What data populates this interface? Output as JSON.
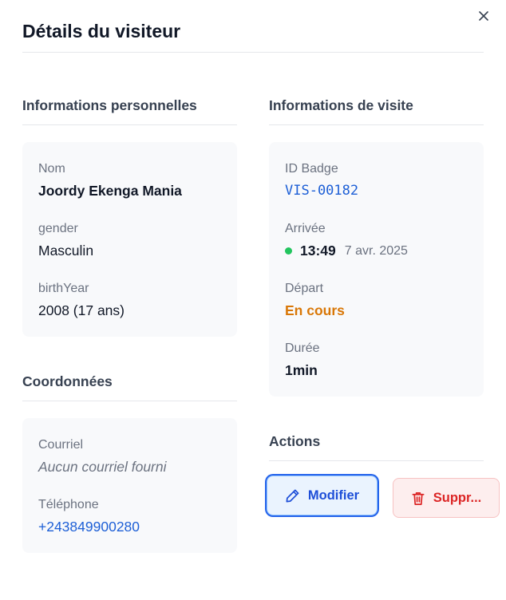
{
  "dialog": {
    "title": "Détails du visiteur"
  },
  "personal": {
    "heading": "Informations personnelles",
    "name_label": "Nom",
    "name_value": "Joordy Ekenga Mania",
    "gender_label": "gender",
    "gender_value": "Masculin",
    "birth_label": "birthYear",
    "birth_value": "2008 (17 ans)"
  },
  "contact": {
    "heading": "Coordonnées",
    "email_label": "Courriel",
    "email_value": "Aucun courriel fourni",
    "phone_label": "Téléphone",
    "phone_value": "+243849900280"
  },
  "visit": {
    "heading": "Informations de visite",
    "badge_label": "ID Badge",
    "badge_value": "VIS-00182",
    "arrival_label": "Arrivée",
    "arrival_time": "13:49",
    "arrival_date": "7 avr. 2025",
    "departure_label": "Départ",
    "departure_value": "En cours",
    "duration_label": "Durée",
    "duration_value": "1min"
  },
  "actions": {
    "heading": "Actions",
    "edit_label": "Modifier",
    "delete_label": "Suppr..."
  },
  "colors": {
    "link_blue": "#1d5fd6",
    "status_green": "#22c55e",
    "status_orange": "#d97706",
    "danger_red": "#dc2626"
  }
}
